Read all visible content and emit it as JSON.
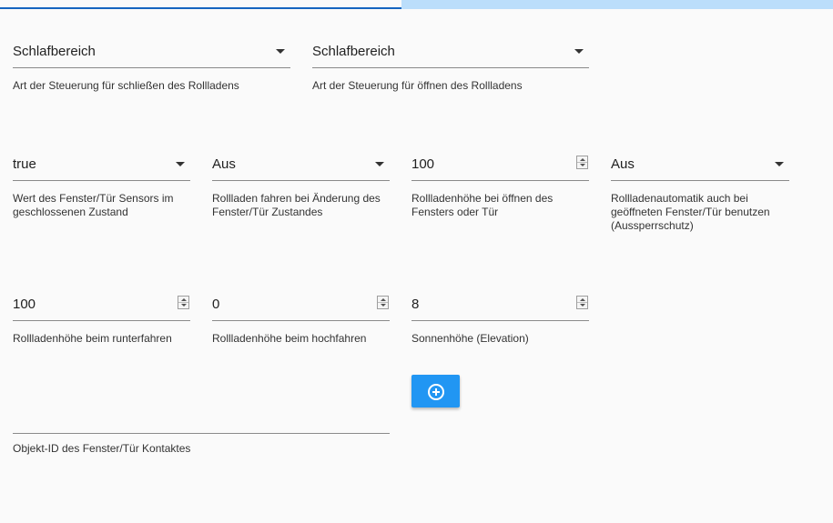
{
  "colors": {
    "accent": "#2196f3",
    "tab_active": "#1565c0",
    "tab_bar": "#bbdefb",
    "background": "#fafafa"
  },
  "close_control": {
    "value": "Schlafbereich",
    "help": "Art der Steuerung für schließen des Rollladens",
    "icon": "chevron-down-icon"
  },
  "open_control": {
    "value": "Schlafbereich",
    "help": "Art der Steuerung für öffnen des Rollladens",
    "icon": "chevron-down-icon"
  },
  "sensor_closed_value": {
    "value": "true",
    "help": "Wert des Fenster/Tür Sensors im geschlossenen Zustand"
  },
  "move_on_change": {
    "value": "Aus",
    "help": "Rollladen fahren bei Änderung des Fenster/Tür Zustandes"
  },
  "height_window_open": {
    "value": "100",
    "help": "Rollladenhöhe bei öffnen des Fensters oder Tür"
  },
  "lockout_protection": {
    "value": "Aus",
    "help": "Rollladenautomatik auch bei geöffneten Fenster/Tür benutzen (Aussperrschutz)"
  },
  "height_down": {
    "value": "100",
    "help": "Rollladenhöhe beim runterfahren"
  },
  "height_up": {
    "value": "0",
    "help": "Rollladenhöhe beim hochfahren"
  },
  "sun_elevation": {
    "value": "8",
    "help": "Sonnenhöhe (Elevation)"
  },
  "add_button": {
    "icon": "add-circle-icon"
  },
  "object_id": {
    "value": "",
    "help": "Objekt-ID des Fenster/Tür Kontaktes"
  }
}
